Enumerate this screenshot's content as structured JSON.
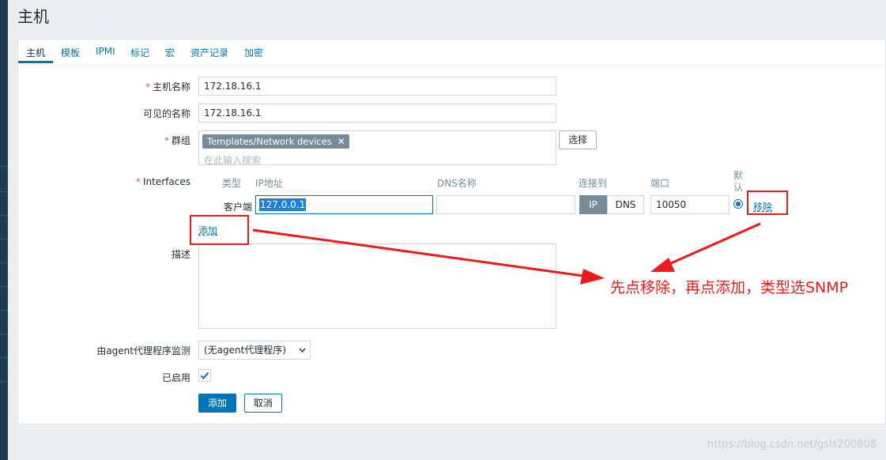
{
  "page": {
    "title": "主机"
  },
  "tabs": [
    "主机",
    "模板",
    "IPMI",
    "标记",
    "宏",
    "资产记录",
    "加密"
  ],
  "form": {
    "host_name": {
      "label": "主机名称",
      "value": "172.18.16.1"
    },
    "visible_name": {
      "label": "可见的名称",
      "value": "172.18.16.1"
    },
    "groups": {
      "label": "群组",
      "tag": "Templates/Network devices",
      "placeholder": "在此输入搜索",
      "select_button": "选择"
    },
    "interfaces": {
      "label": "Interfaces",
      "headers": {
        "type": "类型",
        "ip": "IP地址",
        "dns": "DNS名称",
        "connect": "连接到",
        "port": "端口",
        "default": "默认"
      },
      "row": {
        "type": "客户端",
        "ip": "127.0.0.1",
        "dns": "",
        "ip_toggle": "IP",
        "dns_toggle": "DNS",
        "port": "10050",
        "remove": "移除"
      },
      "add": "添加"
    },
    "description": {
      "label": "描述",
      "value": ""
    },
    "monitored_by": {
      "label": "由agent代理程序监测",
      "value": "(无agent代理程序)"
    },
    "enabled": {
      "label": "已启用",
      "checked": true
    },
    "buttons": {
      "add": "添加",
      "cancel": "取消"
    }
  },
  "annotation": {
    "text": "先点移除，再点添加，类型选SNMP",
    "color": "#ee1a1a"
  },
  "watermark": "https://blog.csdn.net/gsls200808",
  "colors": {
    "accent": "#0275b8",
    "tag_bg": "#768d99",
    "required": "#e45959",
    "sidebar": "#1f3c4e"
  }
}
